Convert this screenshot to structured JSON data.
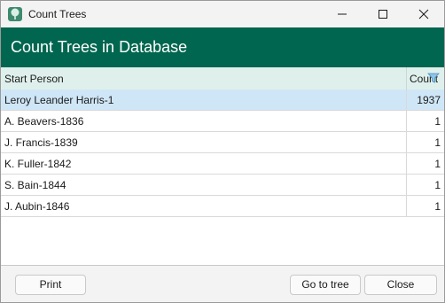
{
  "window": {
    "title": "Count Trees",
    "icon": "tree-icon"
  },
  "header": {
    "title": "Count Trees in Database"
  },
  "grid": {
    "columns": [
      "Start Person",
      "Count"
    ],
    "rows": [
      {
        "name": "Leroy Leander Harris-1",
        "count": "1937"
      },
      {
        "name": "A. Beavers-1836",
        "count": "1"
      },
      {
        "name": "J. Francis-1839",
        "count": "1"
      },
      {
        "name": "K. Fuller-1842",
        "count": "1"
      },
      {
        "name": "S. Bain-1844",
        "count": "1"
      },
      {
        "name": "J. Aubin-1846",
        "count": "1"
      }
    ]
  },
  "buttons": {
    "print": "Print",
    "go_to_tree": "Go to tree",
    "close": "Close"
  },
  "colors": {
    "header_bg": "#00664f",
    "column_header_bg": "#dff0ec",
    "selected_row_bg": "#cfe6f7"
  }
}
